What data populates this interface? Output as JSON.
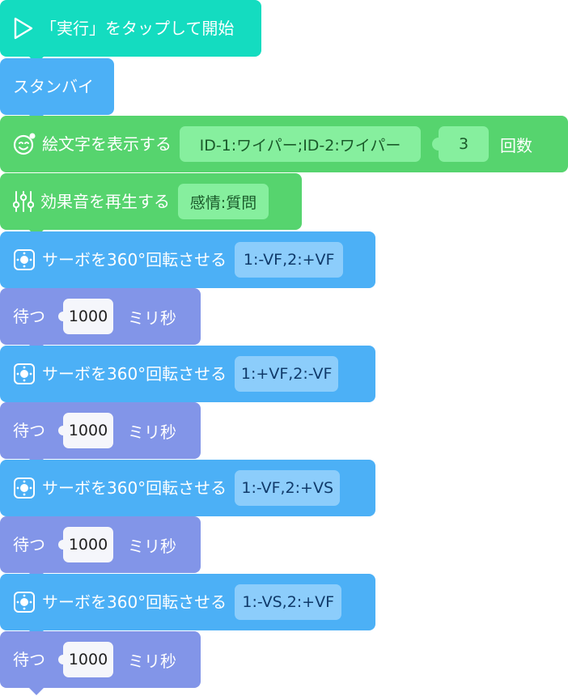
{
  "blocks": {
    "start": {
      "label": "「実行」をタップして開始",
      "icon": "play-icon"
    },
    "standby": {
      "label": "スタンバイ"
    },
    "emoji": {
      "label": "絵文字を表示する",
      "icon": "smiley-icon",
      "value": "ID-1:ワイパー;ID-2:ワイパー",
      "times": "3",
      "suffix": "回数"
    },
    "sound": {
      "label": "効果音を再生する",
      "icon": "sliders-icon",
      "value": "感情:質問"
    },
    "servo1": {
      "label": "サーボを360°回転させる",
      "icon": "servo-icon",
      "value": "1:-VF,2:+VF"
    },
    "wait1": {
      "label": "待つ",
      "value": "1000",
      "suffix": "ミリ秒"
    },
    "servo2": {
      "label": "サーボを360°回転させる",
      "icon": "servo-icon",
      "value": "1:+VF,2:-VF"
    },
    "wait2": {
      "label": "待つ",
      "value": "1000",
      "suffix": "ミリ秒"
    },
    "servo3": {
      "label": "サーボを360°回転させる",
      "icon": "servo-icon",
      "value": "1:-VF,2:+VS"
    },
    "wait3": {
      "label": "待つ",
      "value": "1000",
      "suffix": "ミリ秒"
    },
    "servo4": {
      "label": "サーボを360°回転させる",
      "icon": "servo-icon",
      "value": "1:-VS,2:+VF"
    },
    "wait4": {
      "label": "待つ",
      "value": "1000",
      "suffix": "ミリ秒"
    }
  },
  "colors": {
    "start": "#14dcc0",
    "motion": "#4cb0f6",
    "looks": "#56d46e",
    "control": "#8295e8"
  }
}
